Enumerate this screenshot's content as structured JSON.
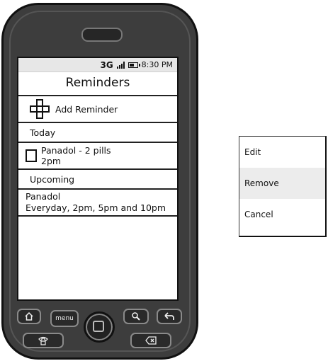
{
  "status_bar": {
    "network": "3G",
    "time": "8:30 PM"
  },
  "screen": {
    "title": "Reminders",
    "add_label": "Add Reminder",
    "sections": [
      {
        "label": "Today"
      },
      {
        "label": "Upcoming"
      }
    ],
    "today_item": {
      "line1": "Panadol - 2 pills",
      "line2": "2pm"
    },
    "upcoming_item": {
      "line1": "Panadol",
      "line2": "Everyday, 2pm, 5pm and 10pm"
    }
  },
  "hardware": {
    "menu_label": "menu"
  },
  "context_menu": {
    "items": [
      {
        "label": "Edit"
      },
      {
        "label": "Remove"
      },
      {
        "label": "Cancel"
      }
    ]
  },
  "colors": {
    "phone_body": "#3d3d3d",
    "status_bar": "#e7e7e7",
    "menu_highlight": "#ececec"
  }
}
